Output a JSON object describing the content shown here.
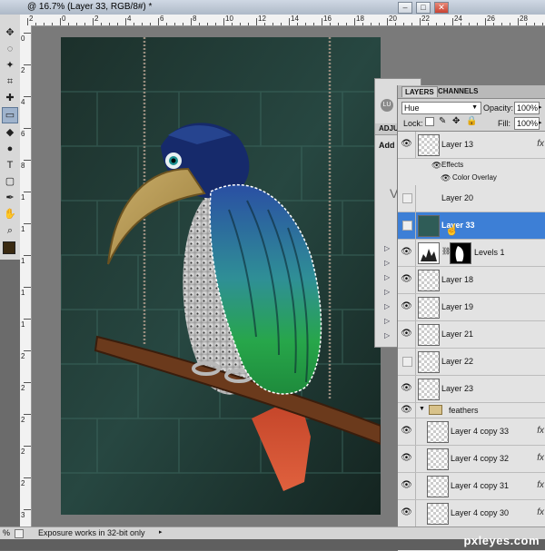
{
  "window": {
    "doc_title": "@ 16.7% (Layer 33, RGB/8#) *",
    "controls": {
      "minimize": "–",
      "maximize": "□",
      "close": "✕"
    }
  },
  "ruler": {
    "top_labels": [
      "2",
      "0",
      "2",
      "4",
      "6",
      "8",
      "10",
      "12",
      "14",
      "16",
      "18",
      "20",
      "22",
      "24",
      "26",
      "28"
    ],
    "left_labels": [
      "0",
      "2",
      "4",
      "6",
      "8",
      "1",
      "1",
      "1",
      "1",
      "1",
      "2",
      "2",
      "2",
      "2",
      "2",
      "3"
    ]
  },
  "tools": {
    "icons": [
      "move-icon",
      "lasso-icon",
      "magic-wand-icon",
      "crop-icon",
      "healing-brush-icon",
      "brush-icon",
      "eraser-icon",
      "blur-icon",
      "type-icon",
      "shape-icon",
      "pen-icon",
      "hand-icon",
      "zoom-icon"
    ],
    "colors": {
      "foreground": "#3a2a12",
      "background": "#ffffff"
    }
  },
  "status": {
    "zoom": "%",
    "message": "Exposure works in 32-bit only"
  },
  "adjustments": {
    "tab_label": "ADJUS",
    "subtitle": "Add a",
    "letter": "V"
  },
  "layers_panel": {
    "tabs": [
      "LAYERS",
      "CHANNELS"
    ],
    "blend_mode": "Hue",
    "opacity_label": "Opacity:",
    "opacity": "100%",
    "lock_label": "Lock:",
    "fill_label": "Fill:",
    "fill": "100%",
    "effects_label": "Effects",
    "color_overlay_label": "Color Overlay",
    "layers": [
      {
        "name": "Layer 13",
        "visible": true,
        "fx": true
      },
      {
        "name": "Layer 20",
        "visible": false,
        "fx": false
      },
      {
        "name": "Layer 33",
        "visible": false,
        "fx": false,
        "selected": true
      },
      {
        "name": "Levels 1",
        "visible": true,
        "fx": false
      },
      {
        "name": "Layer 18",
        "visible": true,
        "fx": false
      },
      {
        "name": "Layer 19",
        "visible": true,
        "fx": false
      },
      {
        "name": "Layer 21",
        "visible": true,
        "fx": false
      },
      {
        "name": "Layer 22",
        "visible": false,
        "fx": false
      },
      {
        "name": "Layer 23",
        "visible": true,
        "fx": false
      },
      {
        "name": "feathers",
        "visible": true,
        "group": true
      },
      {
        "name": "Layer 4 copy 33",
        "visible": true,
        "fx": true
      },
      {
        "name": "Layer 4 copy 32",
        "visible": true,
        "fx": true
      },
      {
        "name": "Layer 4 copy 31",
        "visible": true,
        "fx": true
      },
      {
        "name": "Layer 4 copy 30",
        "visible": true,
        "fx": true
      }
    ],
    "fx_glyph": "fx"
  },
  "watermark": "pxleyes.com"
}
